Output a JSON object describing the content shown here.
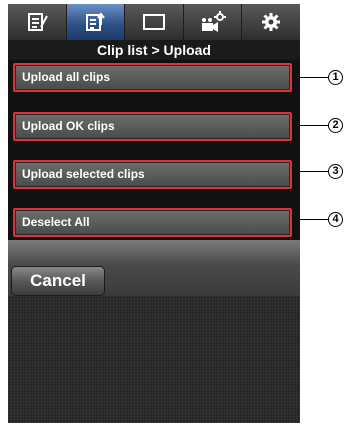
{
  "tabs": [
    {
      "icon": "memo-icon",
      "active": false
    },
    {
      "icon": "clip-upload-icon",
      "active": true
    },
    {
      "icon": "display-icon",
      "active": false
    },
    {
      "icon": "camera-settings-icon",
      "active": false
    },
    {
      "icon": "gear-icon",
      "active": false
    }
  ],
  "title": "Clip list > Upload",
  "menu": {
    "items": [
      {
        "label": "Upload all clips",
        "callout": "1"
      },
      {
        "label": "Upload OK clips",
        "callout": "2"
      },
      {
        "label": "Upload selected clips",
        "callout": "3"
      },
      {
        "label": "Deselect All",
        "callout": "4"
      }
    ]
  },
  "buttons": {
    "cancel_label": "Cancel"
  },
  "colors": {
    "highlight_border": "#e0303a",
    "active_tab": "#2c4f86",
    "background": "#2b2b2b"
  }
}
